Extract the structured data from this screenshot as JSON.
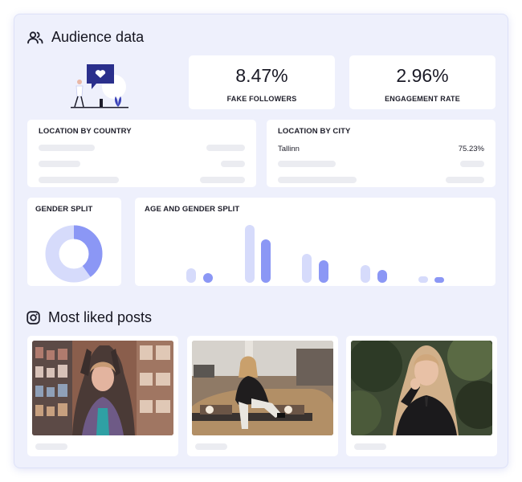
{
  "audience": {
    "title": "Audience data",
    "icon": "users-icon"
  },
  "stats": [
    {
      "value": "8.47%",
      "label": "FAKE FOLLOWERS"
    },
    {
      "value": "2.96%",
      "label": "ENGAGEMENT RATE"
    }
  ],
  "location_country": {
    "title": "LOCATION BY COUNTRY"
  },
  "location_city": {
    "title": "LOCATION BY CITY",
    "rows": [
      {
        "city": "Tallinn",
        "percent": "75.23%"
      }
    ]
  },
  "gender_split": {
    "title": "GENDER SPLIT"
  },
  "age_gender": {
    "title": "AGE AND GENDER SPLIT"
  },
  "posts": {
    "title": "Most liked posts",
    "icon": "instagram-icon"
  },
  "colors": {
    "accent": "#8b97f5",
    "accent_light": "#d6dbfb",
    "panel_bg": "#eef0fc",
    "skeleton": "#ebecf1"
  }
}
